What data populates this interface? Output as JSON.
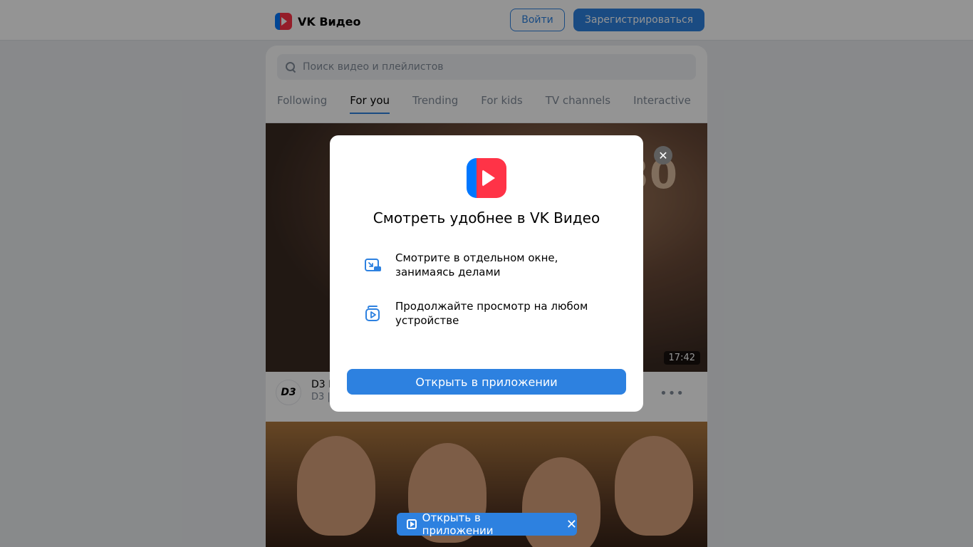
{
  "header": {
    "logo_text": "VK Видео",
    "login_label": "Войти",
    "register_label": "Зарегистрироваться"
  },
  "search": {
    "placeholder": "Поиск видео и плейлистов"
  },
  "tabs": [
    {
      "label": "Following",
      "active": false
    },
    {
      "label": "For you",
      "active": true
    },
    {
      "label": "Trending",
      "active": false
    },
    {
      "label": "For kids",
      "active": false
    },
    {
      "label": "TV channels",
      "active": false
    },
    {
      "label": "Interactive",
      "active": false
    }
  ],
  "video1": {
    "overlay_number": "80",
    "duration": "17:42",
    "channel_avatar": "D3",
    "title": "D3 I",
    "channel": "D3 |"
  },
  "modal": {
    "title": "Смотреть удобнее в VK Видео",
    "features": [
      {
        "icon": "picture-in-picture-icon",
        "text": "Смотрите в отдельном окне, занимаясь делами"
      },
      {
        "icon": "multi-device-icon",
        "text": "Продолжайте просмотр на любом устройстве"
      }
    ],
    "open_button": "Открыть в приложении"
  },
  "bottom_bar": {
    "label": "Открыть в приложении"
  },
  "colors": {
    "accent": "#2d81e0",
    "brand_red": "#ff3347",
    "brand_blue": "#0077ff"
  }
}
